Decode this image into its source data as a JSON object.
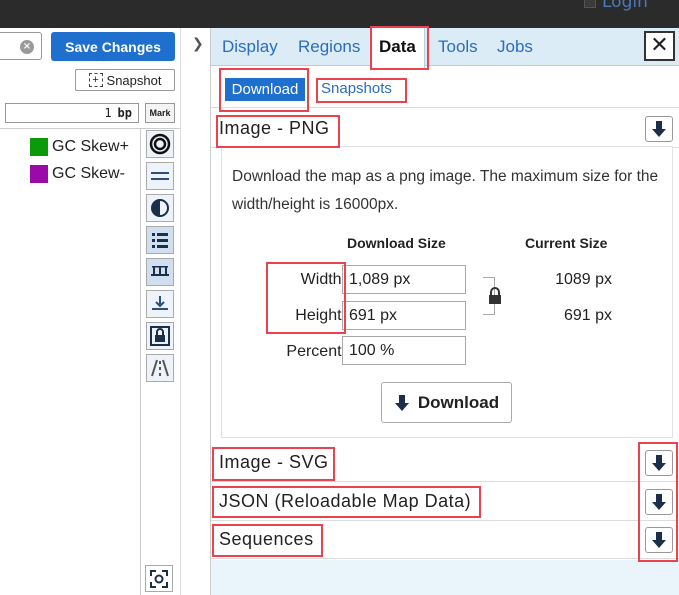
{
  "topbar": {
    "login_label": "Login"
  },
  "left": {
    "save_label": "Save Changes",
    "snapshot_label": "Snapshot",
    "bp_value": "1",
    "bp_unit": "bp",
    "mark_label": "Mark",
    "legend": [
      {
        "label": "GC Skew+",
        "color": "#0a9a0a"
      },
      {
        "label": "GC Skew-",
        "color": "#9b0aa6"
      }
    ]
  },
  "tabs": [
    "Display",
    "Regions",
    "Data",
    "Tools",
    "Jobs"
  ],
  "active_tab": "Data",
  "subtabs": {
    "active": "Download",
    "other": "Snapshots"
  },
  "sections": {
    "png": {
      "title": "Image - PNG",
      "description": "Download the map as a png image. The maximum size for the width/height is 16000px.",
      "download_size_head": "Download Size",
      "current_size_head": "Current Size",
      "width_label": "Width:",
      "height_label": "Height:",
      "percent_label": "Percent:",
      "width_value": "1,089 px",
      "height_value": "691 px",
      "percent_value": "100 %",
      "current_width": "1089 px",
      "current_height": "691 px",
      "download_label": "Download"
    },
    "svg": {
      "title": "Image - SVG"
    },
    "json": {
      "title": "JSON (Reloadable Map Data)"
    },
    "sequences": {
      "title": "Sequences"
    }
  },
  "colors": {
    "accent": "#1f6fce",
    "tab_bg": "#dcecf7",
    "highlight": "#e8434f"
  }
}
